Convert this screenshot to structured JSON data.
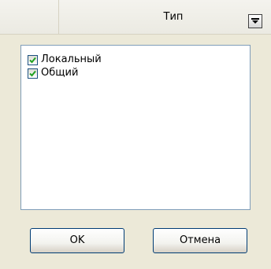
{
  "header": {
    "title": "Тип",
    "dropdown_icon": "chevron-down-icon"
  },
  "list": {
    "items": [
      {
        "label": "Локальный",
        "checked": true
      },
      {
        "label": "Общий",
        "checked": true
      }
    ]
  },
  "buttons": {
    "ok_label": "OK",
    "cancel_label": "Отмена"
  },
  "colors": {
    "background": "#ece9d8",
    "check_mark": "#21a121",
    "border_blue": "#7f9db9",
    "button_border": "#003c74"
  }
}
